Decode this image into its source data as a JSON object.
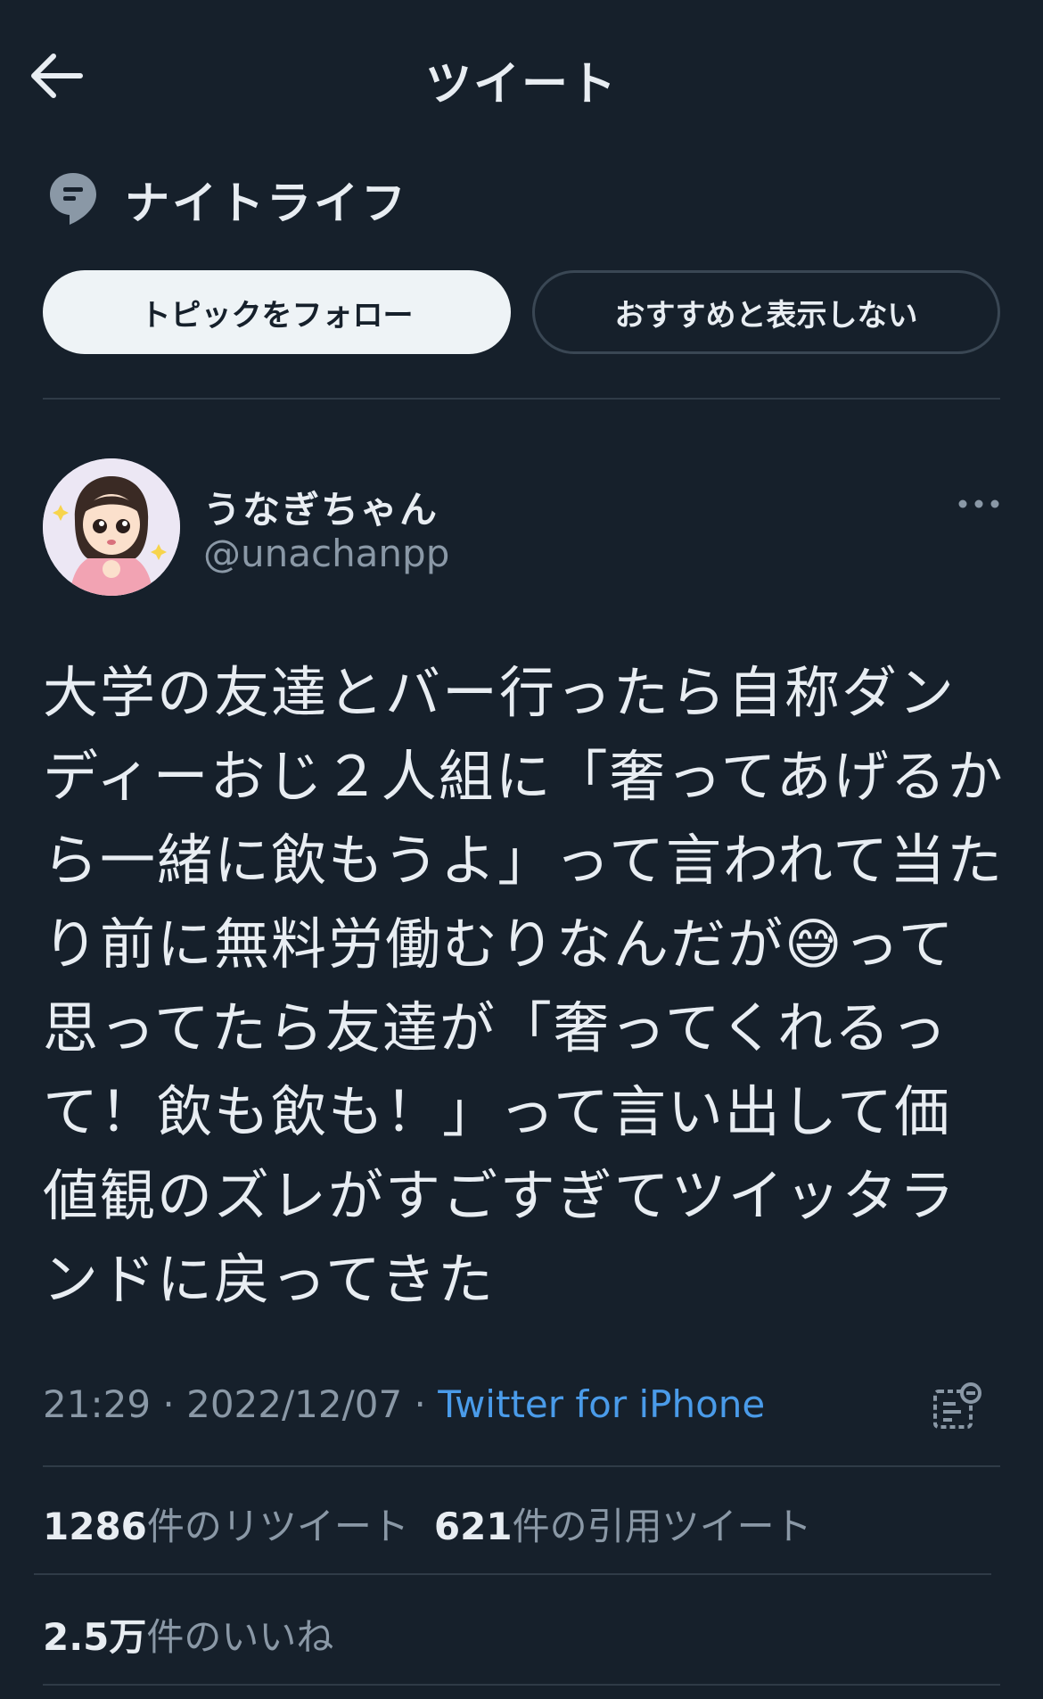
{
  "header": {
    "title": "ツイート",
    "back_icon": "arrow-left-icon"
  },
  "topic": {
    "icon": "topic-speech-bubble-icon",
    "label": "ナイトライフ",
    "follow_label": "トピックをフォロー",
    "hide_label": "おすすめと表示しない"
  },
  "user": {
    "name": "うなぎちゃん",
    "handle": "@unachanpp",
    "avatar": "avatar-illustration"
  },
  "tweet": {
    "text": "大学の友達とバー行ったら自称ダンディーおじ２人組に「奢ってあげるから一緒に飲もうよ」って言われて当たり前に無料労働むりなんだが😅って思ってたら友達が「奢ってくれるって！飲も飲も！」って言い出して価値観のズレがすごすぎてツイッタランドに戻ってきた",
    "time": "21:29",
    "date": "2022/12/07",
    "source": "Twitter for iPhone"
  },
  "stats": {
    "retweets_count": "1286",
    "retweets_label": "件のリツイート",
    "quotes_count": "621",
    "quotes_label": "件の引用ツイート",
    "likes_count": "2.5万",
    "likes_label": "件のいいね"
  },
  "colors": {
    "background": "#16202b",
    "text": "#e8edf2",
    "muted": "#8a98a6",
    "link": "#4a9be9",
    "divider": "#2f3b47"
  }
}
